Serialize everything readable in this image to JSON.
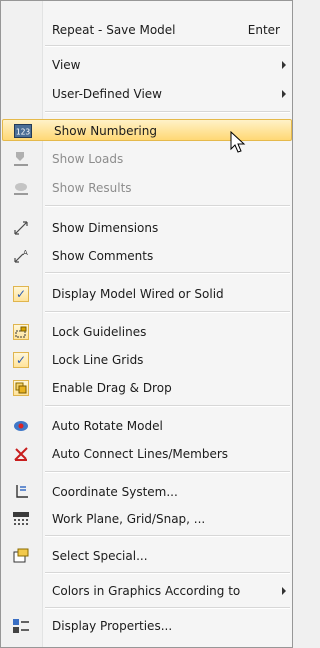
{
  "menu": {
    "items": [
      {
        "label": "Repeat - Save Model",
        "shortcut": "Enter",
        "icon": "none",
        "enabled": true
      },
      {
        "label": "View",
        "submenu": true,
        "icon": "none",
        "enabled": true
      },
      {
        "label": "User-Defined View",
        "submenu": true,
        "icon": "none",
        "enabled": true
      },
      {
        "label": "Show Numbering",
        "icon": "numbering-icon",
        "enabled": true,
        "highlighted": true
      },
      {
        "label": "Show Loads",
        "icon": "loads-icon",
        "enabled": false
      },
      {
        "label": "Show Results",
        "icon": "results-icon",
        "enabled": false
      },
      {
        "label": "Show Dimensions",
        "icon": "dimensions-icon",
        "enabled": true
      },
      {
        "label": "Show Comments",
        "icon": "comments-icon",
        "enabled": true
      },
      {
        "label": "Display Model Wired or Solid",
        "icon": "check-icon",
        "checked": true,
        "enabled": true
      },
      {
        "label": "Lock Guidelines",
        "icon": "lock-guidelines-icon",
        "checked": true,
        "enabled": true
      },
      {
        "label": "Lock Line Grids",
        "icon": "check-icon",
        "checked": true,
        "enabled": true
      },
      {
        "label": "Enable Drag & Drop",
        "icon": "drag-drop-icon",
        "checked": true,
        "enabled": true
      },
      {
        "label": "Auto Rotate Model",
        "icon": "rotate-icon",
        "enabled": true
      },
      {
        "label": "Auto Connect Lines/Members",
        "icon": "connect-icon",
        "enabled": true
      },
      {
        "label": "Coordinate System...",
        "icon": "coordinate-icon",
        "enabled": true
      },
      {
        "label": "Work Plane, Grid/Snap, ...",
        "icon": "grid-icon",
        "enabled": true
      },
      {
        "label": "Select Special...",
        "icon": "select-special-icon",
        "enabled": true
      },
      {
        "label": "Colors in Graphics According to",
        "submenu": true,
        "icon": "none",
        "enabled": true
      },
      {
        "label": "Display Properties...",
        "icon": "display-properties-icon",
        "enabled": true
      }
    ]
  },
  "colors": {
    "highlight_top": "#fff2c8",
    "highlight_bottom": "#ffd875",
    "check": "#2d5bb0"
  }
}
